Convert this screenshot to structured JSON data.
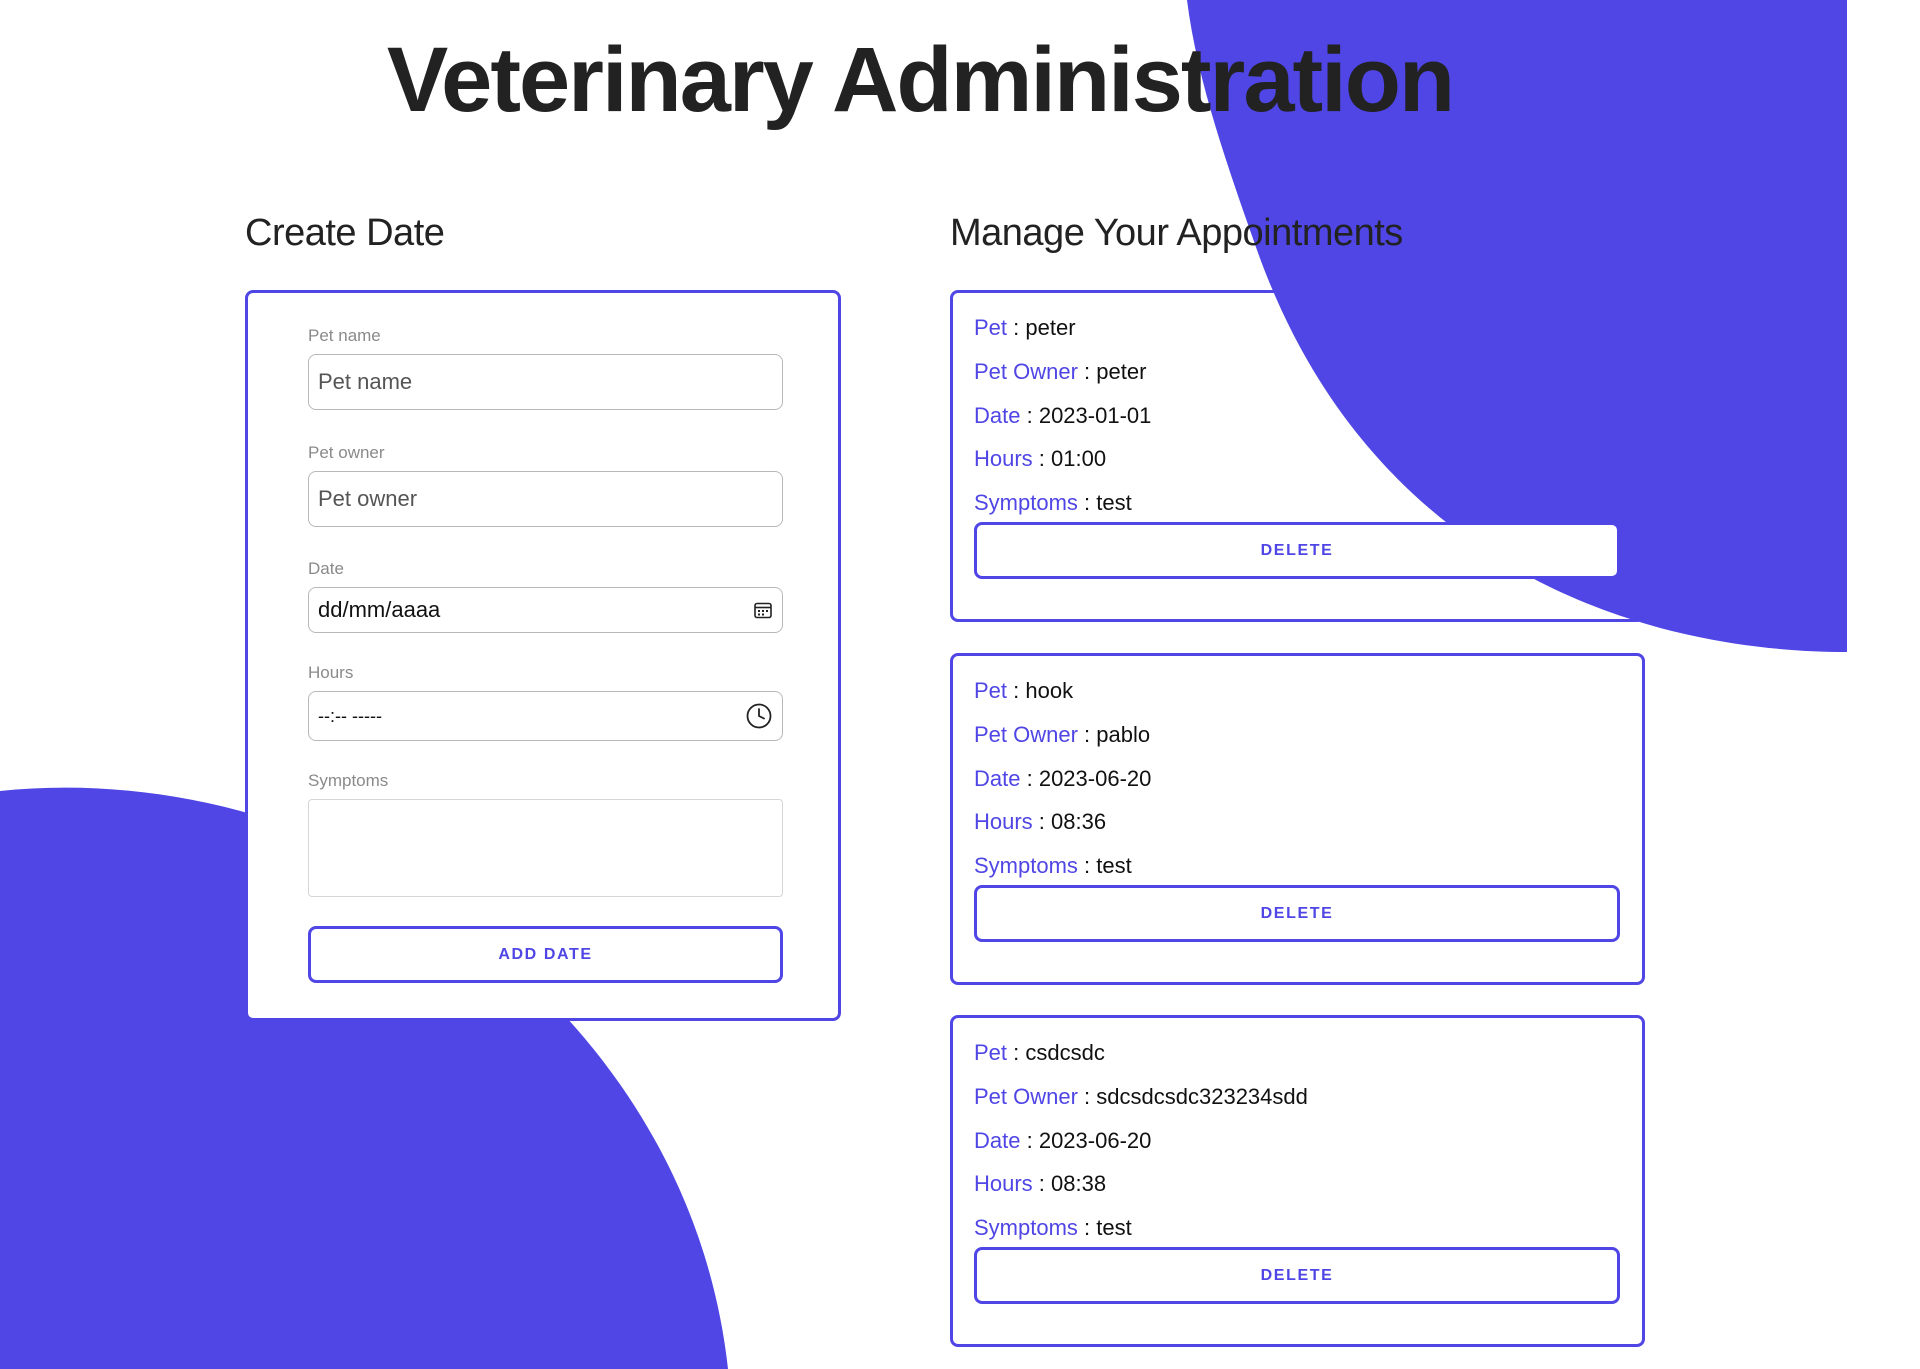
{
  "header": {
    "title": "Veterinary Administration"
  },
  "colors": {
    "accent": "#4f46e5",
    "text": "#222222",
    "label": "#8a8a8a"
  },
  "create_form": {
    "title": "Create Date",
    "pet_name": {
      "label": "Pet name",
      "placeholder": "Pet name"
    },
    "pet_owner": {
      "label": "Pet owner",
      "placeholder": "Pet owner"
    },
    "date": {
      "label": "Date",
      "display": "dd/mm/aaaa",
      "icon": "calendar-icon"
    },
    "hours": {
      "label": "Hours",
      "display": "--:-- -----",
      "icon": "clock-icon"
    },
    "symptoms": {
      "label": "Symptoms"
    },
    "submit_label": "ADD DATE"
  },
  "appointments": {
    "title": "Manage Your Appointments",
    "separator": " : ",
    "field_labels": {
      "pet": "Pet",
      "owner": "Pet Owner",
      "date": "Date",
      "hours": "Hours",
      "symptoms": "Symptoms"
    },
    "delete_label": "DELETE",
    "items": [
      {
        "pet": "peter",
        "owner": "peter",
        "date": "2023-01-01",
        "hours": "01:00",
        "symptoms": "test"
      },
      {
        "pet": "hook",
        "owner": "pablo",
        "date": "2023-06-20",
        "hours": "08:36",
        "symptoms": "test"
      },
      {
        "pet": "csdcsdc",
        "owner": "sdcsdcsdc323234sdd",
        "date": "2023-06-20",
        "hours": "08:38",
        "symptoms": "test"
      }
    ]
  }
}
